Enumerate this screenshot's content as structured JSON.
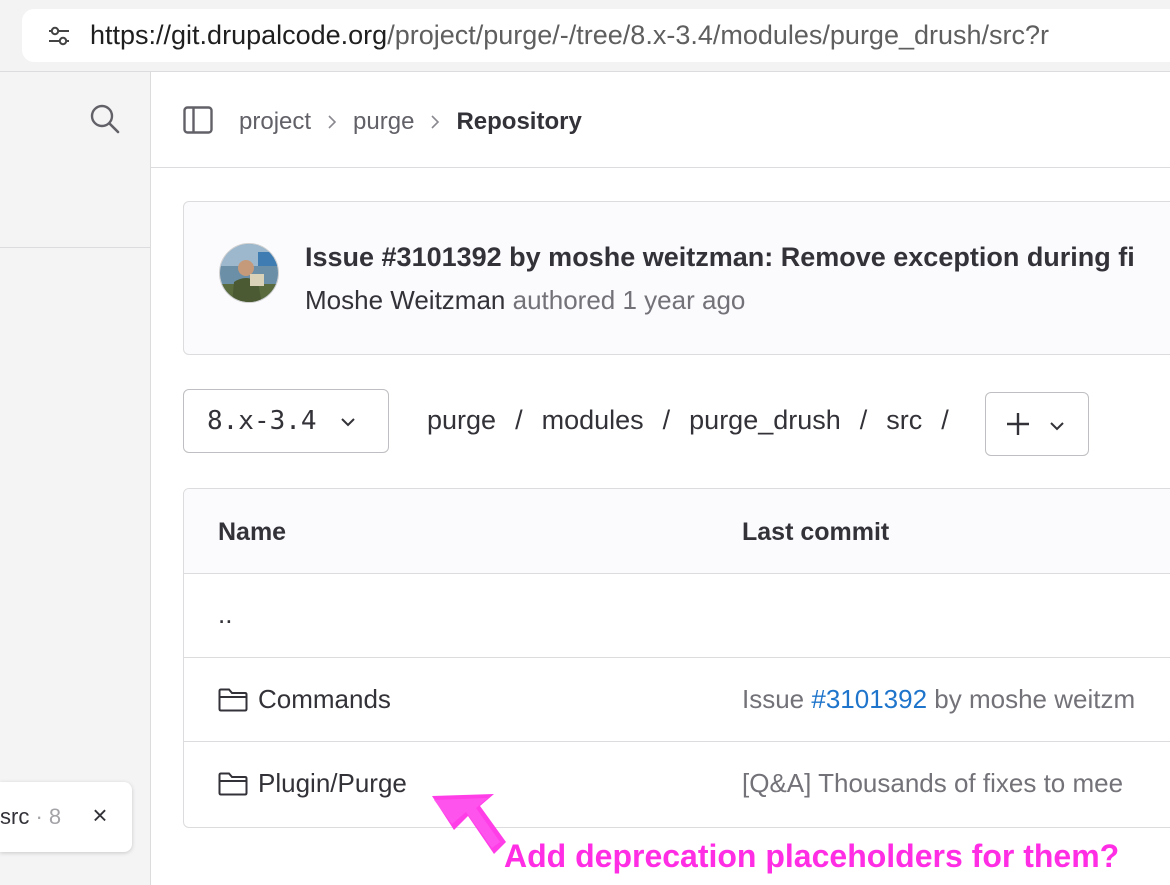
{
  "browser": {
    "url_host": "https://git.drupalcode.org",
    "url_path": "/project/purge/-/tree/8.x-3.4/modules/purge_drush/src?r"
  },
  "sidebar": {
    "search_icon": "search-icon",
    "toast": {
      "text": "src",
      "muted": " · 8",
      "close": "×"
    }
  },
  "header": {
    "toggle_icon": "sidebar-toggle-icon",
    "breadcrumb": [
      "project",
      "purge",
      "Repository"
    ]
  },
  "commit": {
    "title": "Issue #3101392 by moshe weitzman: Remove exception during fi",
    "author": "Moshe Weitzman",
    "action": "authored",
    "time": "1 year ago"
  },
  "branch": {
    "label": "8.x-3.4"
  },
  "path": {
    "segments": [
      "purge",
      "modules",
      "purge_drush",
      "src"
    ],
    "separator": "/"
  },
  "table": {
    "columns": {
      "name": "Name",
      "last_commit": "Last commit"
    },
    "up_row": "..",
    "rows": [
      {
        "name": "Commands",
        "msg_prefix": "Issue ",
        "msg_link": "#3101392",
        "msg_suffix": " by moshe weitzm"
      },
      {
        "name": "Plugin/Purge",
        "msg_prefix": "[Q&A] Thousands of fixes to mee",
        "msg_link": "",
        "msg_suffix": ""
      }
    ]
  },
  "annotation": {
    "text": "Add deprecation placeholders for them?",
    "color": "#ff2ee5"
  },
  "colors": {
    "link": "#1f75cb",
    "border": "#dcdcde",
    "sidebar_bg": "#f4f4f5"
  }
}
